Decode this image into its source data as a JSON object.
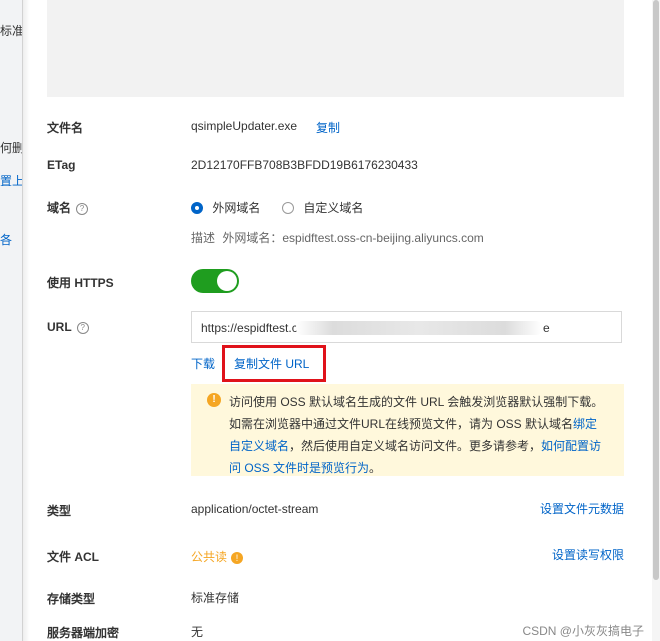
{
  "left_pane": {
    "item1": "标准",
    "item2": "何删",
    "item3": "置上",
    "item4": "各"
  },
  "fields": {
    "filename_label": "文件名",
    "filename_value": "qsimpleUpdater.exe",
    "copy_label": "复制",
    "etag_label": "ETag",
    "etag_value": "2D12170FFB708B3BFDD19B6176230433",
    "domain_label": "域名",
    "domain_option_public": "外网域名",
    "domain_option_custom": "自定义域名",
    "domain_desc_prefix": "描述",
    "domain_desc_text": "外网域名：espidftest.oss-cn-beijing.aliyuncs.com",
    "https_label": "使用 HTTPS",
    "https_enabled": true,
    "url_label": "URL",
    "url_prefix": "https://espidftest.c",
    "url_suffix": "e",
    "download_label": "下载",
    "copy_url_label": "复制文件 URL",
    "type_label": "类型",
    "type_value": "application/octet-stream",
    "set_meta_label": "设置文件元数据",
    "acl_label": "文件 ACL",
    "acl_value": "公共读",
    "set_acl_label": "设置读写权限",
    "storage_label": "存储类型",
    "storage_value": "标准存储",
    "encryption_label": "服务器端加密",
    "encryption_value": "无"
  },
  "notice": {
    "line1": "访问使用 OSS 默认域名生成的文件 URL 会触发浏览器默认强制下载。",
    "line2_prefix": "如需在浏览器中通过文件URL在线预览文件，请为 OSS 默认域名",
    "line2_link": "绑定自定义域名",
    "line2_suffix": "，然后使用自定义域名访问文件。更多请参考，",
    "line2_link2": "如何配置访问 OSS 文件时是预览行为",
    "line2_end": "。"
  },
  "watermark": "CSDN @小灰灰搞电子",
  "colors": {
    "link": "#0064c8",
    "toggle_on": "#1f9d1f",
    "highlight_box": "#e0121a",
    "notice_bg": "#fff8dc",
    "warning": "#f5a623"
  }
}
